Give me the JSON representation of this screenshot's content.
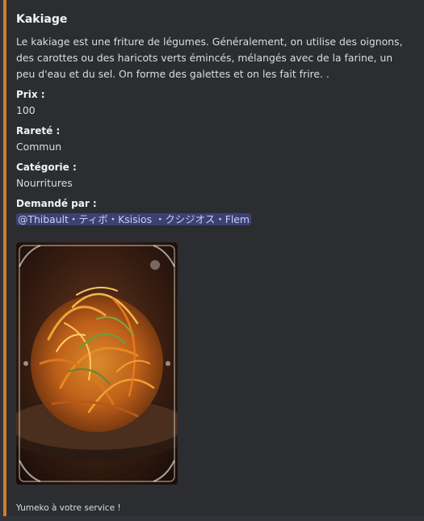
{
  "embed": {
    "accent_color": "#d17a2d",
    "title": "Kakiage",
    "description": "Le kakiage est une friture de légumes. Généralement, on utilise des oignons, des carottes ou des haricots verts émincés, mélangés avec de la farine, un peu d'eau et du sel. On forme des galettes et on les fait frire. .",
    "fields": [
      {
        "name": "Prix :",
        "value": "100"
      },
      {
        "name": "Rareté :",
        "value": "Commun"
      },
      {
        "name": "Catégorie :",
        "value": "Nourritures"
      },
      {
        "name": "Demandé par :",
        "value": "@Thibault・ティボ・Ksisios ・クシジオス・Flem"
      }
    ],
    "footer": "Yumeko à votre service !"
  }
}
